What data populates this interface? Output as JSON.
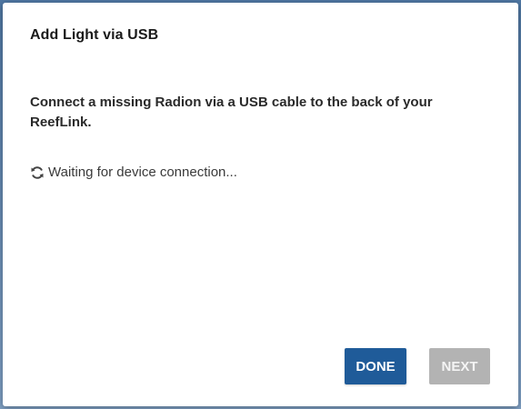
{
  "dialog": {
    "title": "Add Light via USB",
    "message": "Connect a missing Radion via a USB cable to the back of your ReefLink.",
    "status": {
      "icon": "refresh-icon",
      "text": "Waiting for device connection..."
    },
    "buttons": {
      "done_label": "DONE",
      "next_label": "NEXT",
      "next_disabled": true
    },
    "colors": {
      "primary": "#1f5b99",
      "disabled": "#b3b3b3"
    }
  }
}
